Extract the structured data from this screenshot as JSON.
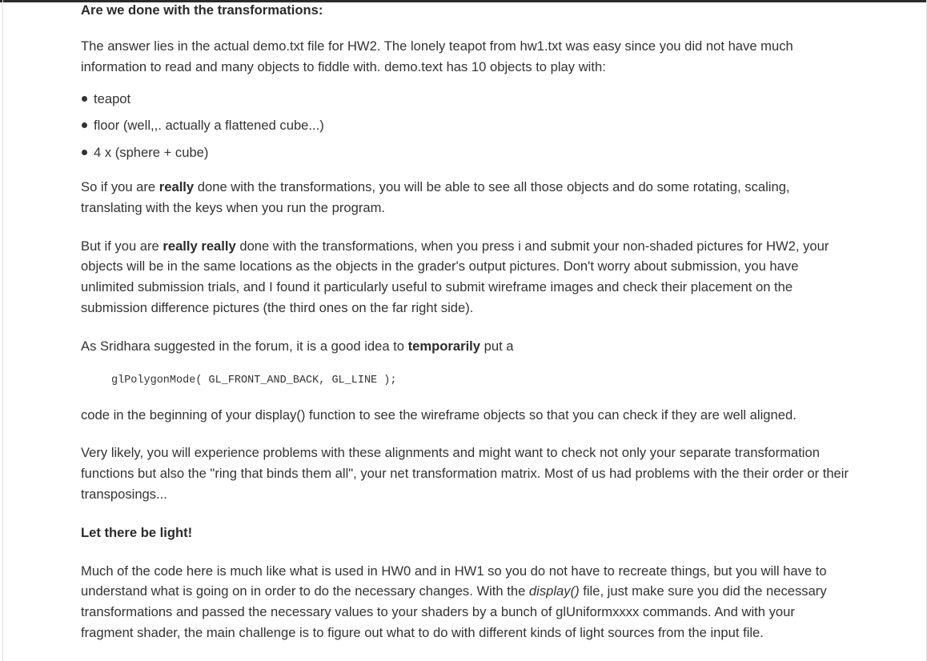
{
  "article": {
    "heading_transformations": "Are we done with the transformations:",
    "para1": "The answer lies in the actual demo.txt file for HW2. The lonely teapot from hw1.txt was easy since you did not have much information to read and many objects to fiddle with. demo.text has 10 objects to play with:",
    "objects": [
      "teapot",
      "floor (well,,. actually a flattened cube...)",
      "4 x (sphere + cube)"
    ],
    "para2_pre": "So if you are ",
    "para2_bold": "really",
    "para2_post": " done with the transformations, you will be able to see all those objects and do some rotating, scaling, translating with the keys when you run the program.",
    "para3_pre": "But if you are ",
    "para3_bold": "really really",
    "para3_post": " done with the transformations, when you press i and submit your non-shaded pictures for HW2, your objects will be in the same locations as the objects in the grader's output pictures. Don't worry about submission, you have unlimited submission trials, and I found it particularly useful to submit wireframe images and check their placement on the submission difference pictures (the third ones on the far right side).",
    "para4_pre": "As Sridhara suggested in the forum, it is a good idea to ",
    "para4_bold": "temporarily",
    "para4_post": " put a",
    "code_line": "glPolygonMode( GL_FRONT_AND_BACK, GL_LINE );",
    "para5": "code in the beginning of your display() function to see the wireframe objects so that you can check if they are well aligned.",
    "para6": "Very likely, you will experience problems with these alignments and might want to check not only your separate transformation functions but also the \"ring that binds them all\", your net transformation matrix. Most of us had problems with the their order or their transposings...",
    "heading_light": "Let there be light!",
    "para7_pre": "Much of the code here is much like what is used in HW0 and in HW1 so you do not have to recreate things, but you will have to understand what is going on in order to do the necessary changes. With the ",
    "para7_em": "display()",
    "para7_post": " file, just make sure you did the necessary transformations and passed the necessary values to your shaders by a bunch of glUniformxxxx commands. And with your fragment shader, the main challenge is to figure out what to do with different kinds of light sources from the input file."
  }
}
